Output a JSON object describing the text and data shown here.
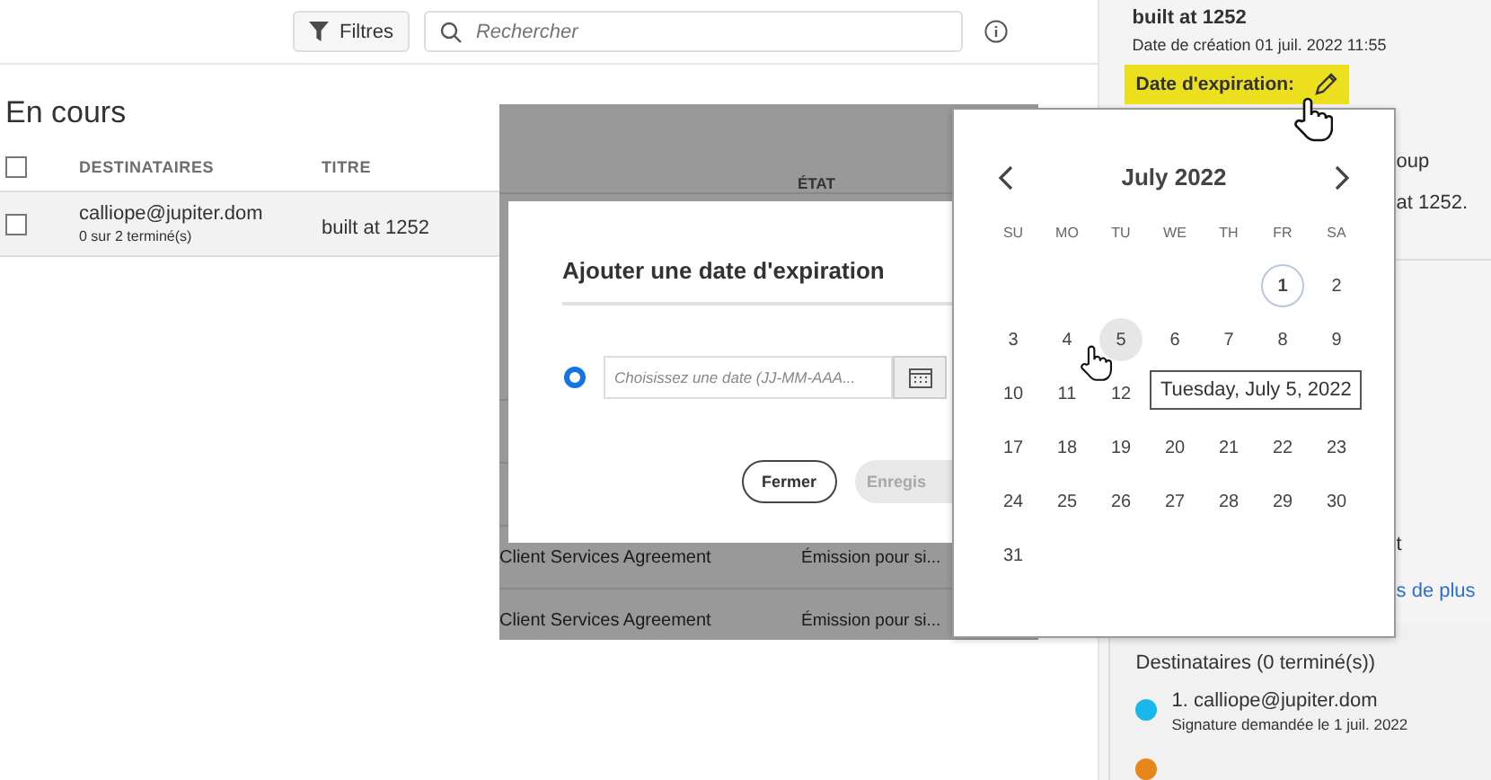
{
  "toolbar": {
    "filter_button": "Filtres",
    "search": {
      "placeholder": "Rechercher"
    }
  },
  "heading": "En cours",
  "table": {
    "select_all": {
      "checked": false
    },
    "columns": [
      "DESTINATAIRES",
      "TITRE"
    ],
    "rows": [
      {
        "checked": false,
        "recipient": "calliope@jupiter.dom",
        "progress": "0 sur 2 terminé(s)",
        "title": "built at 1252"
      }
    ]
  },
  "backdrop_table": {
    "columns": [
      "ÉTAT"
    ],
    "rows": [
      {
        "title": "Client Services Agreement",
        "status": "Émission pour si..."
      },
      {
        "title": "Client Services Agreement",
        "status": "Émission pour si..."
      }
    ]
  },
  "dialog": {
    "title": "Ajouter une date d'expiration",
    "radio": {
      "selected": true
    },
    "date_field": {
      "placeholder": "Choisissez une date (JJ-MM-AAA..."
    },
    "buttons": [
      {
        "label": "Fermer",
        "disabled": false
      },
      {
        "label": "Enregis",
        "disabled": true
      }
    ]
  },
  "date_picker": {
    "month": "July 2022",
    "weekdays": [
      "SU",
      "MO",
      "TU",
      "WE",
      "TH",
      "FR",
      "SA"
    ],
    "weeks": [
      [
        {
          "kind": "blank"
        },
        {
          "kind": "blank"
        },
        {
          "kind": "blank"
        },
        {
          "kind": "blank"
        },
        {
          "kind": "blank"
        },
        {
          "kind": "day",
          "label": "1",
          "today": true,
          "hovered": false
        },
        {
          "label": "2",
          "today": false,
          "hovered": false
        }
      ],
      [
        {
          "label": "3",
          "today": false,
          "hovered": false
        },
        {
          "label": "4",
          "today": false,
          "hovered": false
        },
        {
          "label": "5",
          "today": false,
          "hovered": true
        },
        {
          "label": "6",
          "today": false,
          "hovered": false
        },
        {
          "label": "7",
          "today": false,
          "hovered": false
        },
        {
          "label": "8",
          "today": false,
          "hovered": false
        },
        {
          "label": "9",
          "today": false,
          "hovered": false
        }
      ],
      [
        {
          "label": "10",
          "today": false,
          "hovered": false
        },
        {
          "label": "11",
          "today": false,
          "hovered": false
        },
        {
          "label": "12",
          "today": false,
          "hovered": false
        },
        {
          "kind": "blank"
        },
        {
          "kind": "blank"
        },
        {
          "kind": "blank"
        },
        {
          "kind": "blank"
        }
      ],
      [
        {
          "label": "17",
          "today": false,
          "hovered": false
        },
        {
          "label": "18",
          "today": false,
          "hovered": false
        },
        {
          "label": "19",
          "today": false,
          "hovered": false
        },
        {
          "label": "20",
          "today": false,
          "hovered": false
        },
        {
          "label": "21",
          "today": false,
          "hovered": false
        },
        {
          "label": "22",
          "today": false,
          "hovered": false
        },
        {
          "label": "23",
          "today": false,
          "hovered": false
        }
      ],
      [
        {
          "label": "24",
          "today": false,
          "hovered": false
        },
        {
          "label": "25",
          "today": false,
          "hovered": false
        },
        {
          "label": "26",
          "today": false,
          "hovered": false
        },
        {
          "label": "27",
          "today": false,
          "hovered": false
        },
        {
          "label": "28",
          "today": false,
          "hovered": false
        },
        {
          "label": "29",
          "today": false,
          "hovered": false
        },
        {
          "label": "30",
          "today": false,
          "hovered": false
        }
      ],
      [
        {
          "label": "31",
          "today": false,
          "hovered": false
        },
        {
          "kind": "blank"
        },
        {
          "kind": "blank"
        },
        {
          "kind": "blank"
        },
        {
          "kind": "blank"
        },
        {
          "kind": "blank"
        },
        {
          "kind": "blank"
        }
      ]
    ],
    "tooltip": "Tuesday, July 5, 2022"
  },
  "side_panel": {
    "title": "built at 1252",
    "created": "Date de création 01 juil. 2022 11:55",
    "expiration_label": "Date d'expiration:",
    "partial_lines": [
      "oup",
      "at 1252."
    ],
    "partial_line_lower": "t",
    "more_link": "s de plus",
    "recipients_heading": "Destinataires (0 terminé(s))",
    "recipients": [
      {
        "label": "1. calliope@jupiter.dom",
        "detail": "Signature demandée le 1 juil. 2022",
        "color": "#1ab7ea"
      },
      {
        "color": "#e68619"
      }
    ]
  }
}
